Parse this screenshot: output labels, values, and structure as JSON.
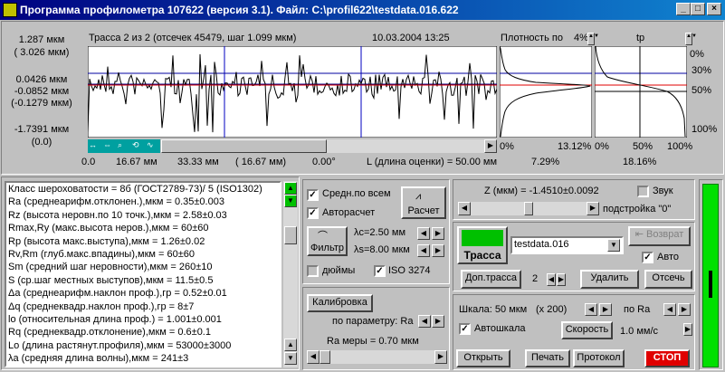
{
  "title": "Программа профилометра 107622 (версия 3.1).   Файл:   C:\\profil622\\testdata.016.622",
  "win": {
    "min": "_",
    "max": "□",
    "close": "×"
  },
  "trace": {
    "y_top": "1.287 мкм",
    "y_top2": "( 3.026 мкм)",
    "y_mid1": "0.0426 мкм",
    "y_mid2": "-0.0852 мкм",
    "y_mid3": "(-0.1279 мкм)",
    "y_bot": "-1.7391 мкм",
    "y_bot2": "(0.0)",
    "header": "Трасса 2 из 2 (отсечек 45479, шаг 1.099 мкм)",
    "date": "10.03.2004  13:25",
    "density": "Плотность по",
    "density_val": "4%",
    "tp": "tp",
    "pct_0": "0%",
    "pct_30": "30%",
    "pct_50": "50%",
    "pct_100": "100%",
    "x_ticks": [
      "0.0",
      "16.67 мм",
      "33.33 мм",
      "( 16.67 мм)",
      "0.00°",
      "L (длина оценки) = 50.00 мм"
    ],
    "dens_axis": [
      "0%",
      "13.12%"
    ],
    "dens_under": "7.29%",
    "tp_axis": [
      "0%",
      "50%",
      "100%"
    ],
    "tp_under": "18.16%"
  },
  "classes": [
    "Класс шероховатости = 8б (ГОСТ2789-73)/ 5 (ISO1302)",
    "Ra (среднеарифм.отклонен.),мкм       = 0.35±0.003",
    "Rz (высота неровн.по 10 точк.),мкм  = 2.58±0.03",
    "Rmax,Ry (макс.высота неров.),мкм   = 60±60",
    "Rp (высота макс.выступа),мкм          = 1.26±0.02",
    "Rv,Rm (глуб.макс.впадины),мкм        = 60±60",
    "Sm (средний шаг неровности),мкм      = 260±10",
    "S (ср.шаг местных выступов),мкм       = 11.5±0.5",
    "Δa (среднеарифм.наклон проф.),гр     = 0.52±0.01",
    "Δq (среднеквадр.наклон проф.),гр     = 8±7",
    "lo (относительная длина проф.)           = 1.001±0.001",
    "Rq (среднеквадр.отклонение),мкм       = 0.6±0.1",
    "Lo (длина растянут.профиля),мкм       = 53000±3000",
    "λa (средняя длина волны),мкм            = 241±3",
    "λq (среднеквадр.дл.волны),мкм          = 80±70"
  ],
  "filters": {
    "avg_all": "Средн.по всем",
    "autocalc": "Авторасчет",
    "calc": "Расчет",
    "filter": "Фильтр",
    "lc": "λc=2.50 мм",
    "ls": "λs=8.00 мкм",
    "inches": "дюймы",
    "iso": "ISO 3274",
    "calib": "Калибровка",
    "by_param": "по параметру: Ra",
    "ra_measure": "Ra меры =  0.70 мкм"
  },
  "z": {
    "value": "Z (мкм) = -1.4510±0.0092",
    "sound": "Звук",
    "tune": "подстройка \"0\""
  },
  "track": {
    "btn": "Трасса",
    "file": "testdata.016",
    "back": "Возврат",
    "auto": "Авто",
    "add": "Доп.трасса",
    "count": "2",
    "delete": "Удалить",
    "cutoff": "Отсечь"
  },
  "scale": {
    "label": "Шкала: 50 мкм",
    "zoom": "(x 200)",
    "by": "по Ra",
    "autoscale": "Автошкала",
    "speed": "Скорость",
    "speed_val": "1.0 мм/с"
  },
  "bottom": {
    "open": "Открыть",
    "print": "Печать",
    "protocol": "Протокол",
    "stop": "СТОП"
  },
  "colors": {
    "title_start": "#000080",
    "title_end": "#1084d0",
    "stop": "#e00000",
    "track_icon": "#00c000",
    "indicator": "#00e000"
  }
}
